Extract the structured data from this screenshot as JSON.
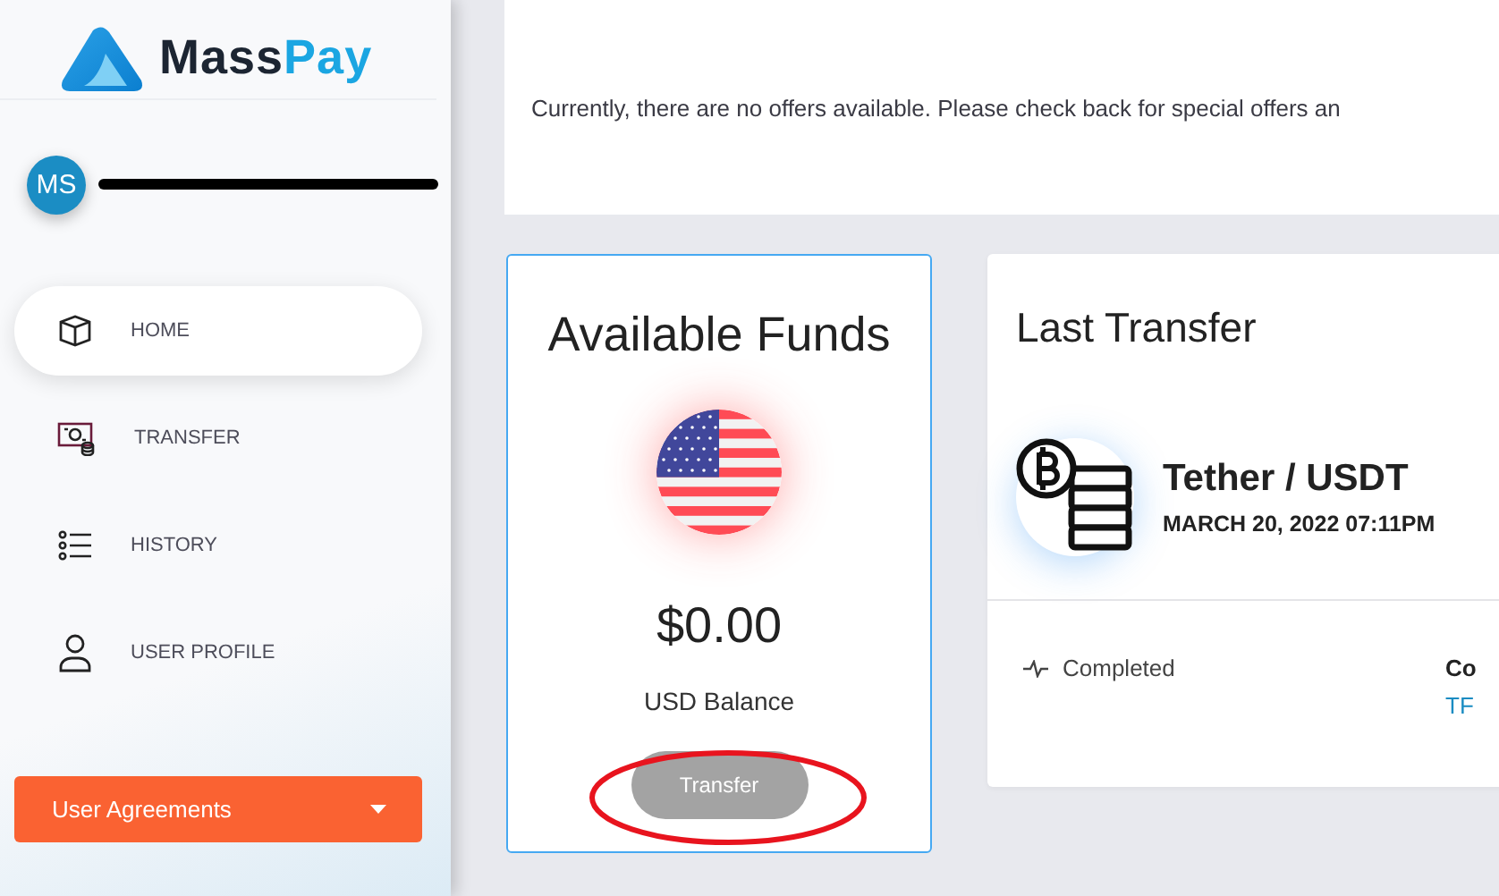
{
  "sidebar": {
    "brand": {
      "parts": [
        "Mass",
        "Pay"
      ]
    },
    "user": {
      "initials": "MS"
    },
    "nav": [
      {
        "label": "HOME",
        "selected": true
      },
      {
        "label": "TRANSFER",
        "selected": false
      },
      {
        "label": "HISTORY",
        "selected": false
      },
      {
        "label": "USER PROFILE",
        "selected": false
      }
    ],
    "agreements_button": "User Agreements"
  },
  "offers": {
    "message": "Currently, there are no offers available. Please check back for special offers an"
  },
  "funds": {
    "title": "Available Funds",
    "amount": "$0.00",
    "currency_label": "USD Balance",
    "button": {
      "label": "Transfer",
      "disabled": true
    }
  },
  "last_transfer": {
    "title": "Last Transfer",
    "asset": "Tether / USDT",
    "date": "MARCH 20, 2022 07:11PM",
    "status": "Completed",
    "column_2_heading": "Co",
    "column_2_value": "TF"
  }
}
